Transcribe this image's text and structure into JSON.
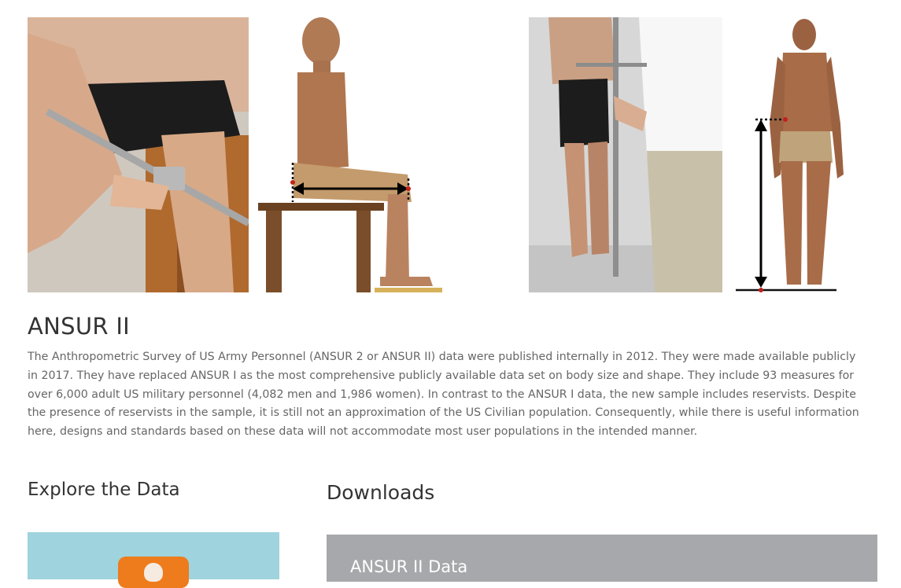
{
  "section": {
    "title": "ANSUR II",
    "description": "The Anthropometric Survey of US Army Personnel (ANSUR 2 or ANSUR II) data were published internally in 2012. They were made available publicly in 2017. They have replaced ANSUR I as the most comprehensive publicly available data set on body size and shape. They include 93 measures for over 6,000 adult US military personnel (4,082 men and 1,986 women). In contrast to the ANSUR I data, the new sample includes reservists. Despite the presence of reservists in the sample, it is still not an approximation of the US Civilian population. Consequently, while there is useful information here, designs and standards based on these data will not accommodate most user populations in the intended manner."
  },
  "explore": {
    "heading": "Explore the Data",
    "icon": "app-icon"
  },
  "downloads": {
    "heading": "Downloads",
    "cards": [
      {
        "title": "ANSUR II Data"
      }
    ]
  },
  "images": [
    {
      "name": "seated-measurement-photo",
      "icon": "photo"
    },
    {
      "name": "seated-measurement-diagram",
      "icon": "diagram"
    },
    {
      "name": "standing-measurement-photo",
      "icon": "photo"
    },
    {
      "name": "standing-measurement-diagram",
      "icon": "diagram"
    }
  ],
  "colors": {
    "background": "#ffffff",
    "heading": "#333333",
    "body_text": "#666666",
    "explore_card": "#9fd3dd",
    "app_icon": "#ee7b1c",
    "download_card": "#a7a8ab",
    "download_text": "#ffffff"
  }
}
